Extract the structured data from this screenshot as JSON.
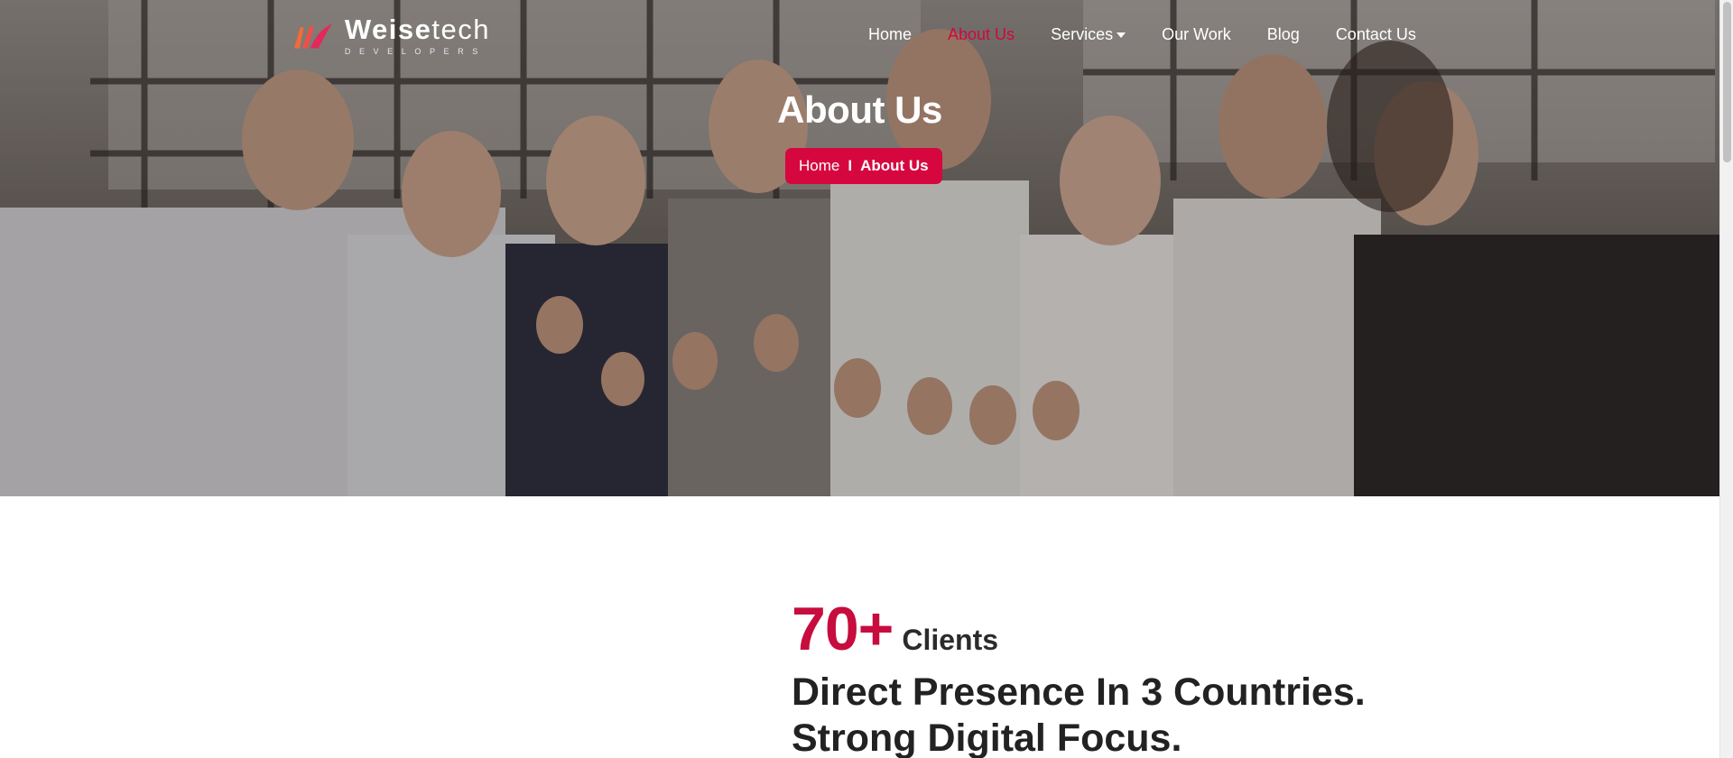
{
  "brand": {
    "name_bold": "Weise",
    "name_light": "tech",
    "tagline": "DEVELOPERS",
    "accent_color": "#d5063d",
    "logo_colors": [
      "#f26b3a",
      "#e4285c"
    ]
  },
  "nav": {
    "items": [
      {
        "label": "Home",
        "active": false
      },
      {
        "label": "About Us",
        "active": true
      },
      {
        "label": "Services",
        "active": false,
        "has_dropdown": true
      },
      {
        "label": "Our Work",
        "active": false
      },
      {
        "label": "Blog",
        "active": false
      },
      {
        "label": "Contact Us",
        "active": false
      }
    ]
  },
  "hero": {
    "title": "About Us",
    "breadcrumb": {
      "home": "Home",
      "separator": "I",
      "current": "About Us"
    }
  },
  "stats": {
    "number": "70+",
    "label": "Clients"
  },
  "headline": {
    "line1": "Direct Presence In 3 Countries.",
    "line2": "Strong Digital Focus."
  }
}
